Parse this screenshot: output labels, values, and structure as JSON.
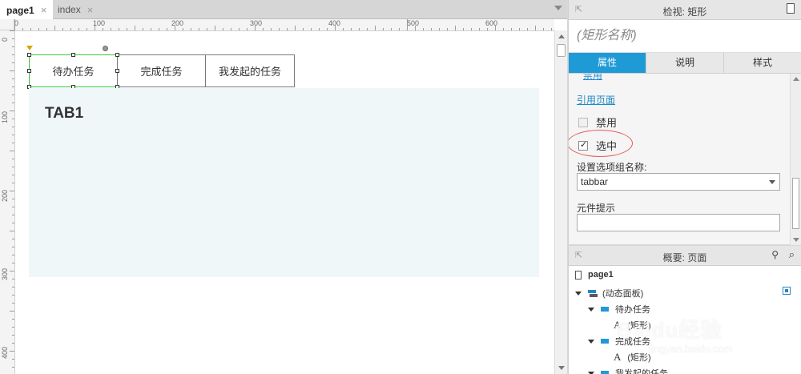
{
  "doc_tabs": [
    {
      "label": "page1",
      "active": true
    },
    {
      "label": "index",
      "active": false
    }
  ],
  "ruler": {
    "h_labels": [
      "0",
      "100",
      "200",
      "300",
      "400",
      "500",
      "600"
    ],
    "v_labels": [
      "0",
      "100",
      "200",
      "300",
      "400"
    ]
  },
  "canvas": {
    "tabs": [
      "待办任务",
      "完成任务",
      "我发起的任务"
    ],
    "panel_title": "TAB1"
  },
  "inspector": {
    "header": "检视: 矩形",
    "shape_name": "(矩形名称)",
    "tabs": [
      "属性",
      "说明",
      "样式"
    ],
    "top_link": "禁用",
    "ref_link": "引用页面",
    "disabled_label": "禁用",
    "selected_label": "选中",
    "group_label": "设置选项组名称:",
    "group_value": "tabbar",
    "tooltip_label": "元件提示",
    "tooltip_value": ""
  },
  "outline": {
    "header": "概要: 页面",
    "items": [
      {
        "label": "page1"
      },
      {
        "label": "(动态面板)"
      },
      {
        "label": "待办任务"
      },
      {
        "label": "(矩形)"
      },
      {
        "label": "完成任务"
      },
      {
        "label": "(矩形)"
      },
      {
        "label": "我发起的任务"
      }
    ]
  },
  "watermark": {
    "brand": "Baidu经验",
    "url": "jingyan.baidu.com"
  },
  "colors": {
    "accent": "#1e9ad6",
    "selection": "#3ac43a",
    "panel_bg": "#f0f7f9",
    "annotation": "#e05a5a"
  }
}
